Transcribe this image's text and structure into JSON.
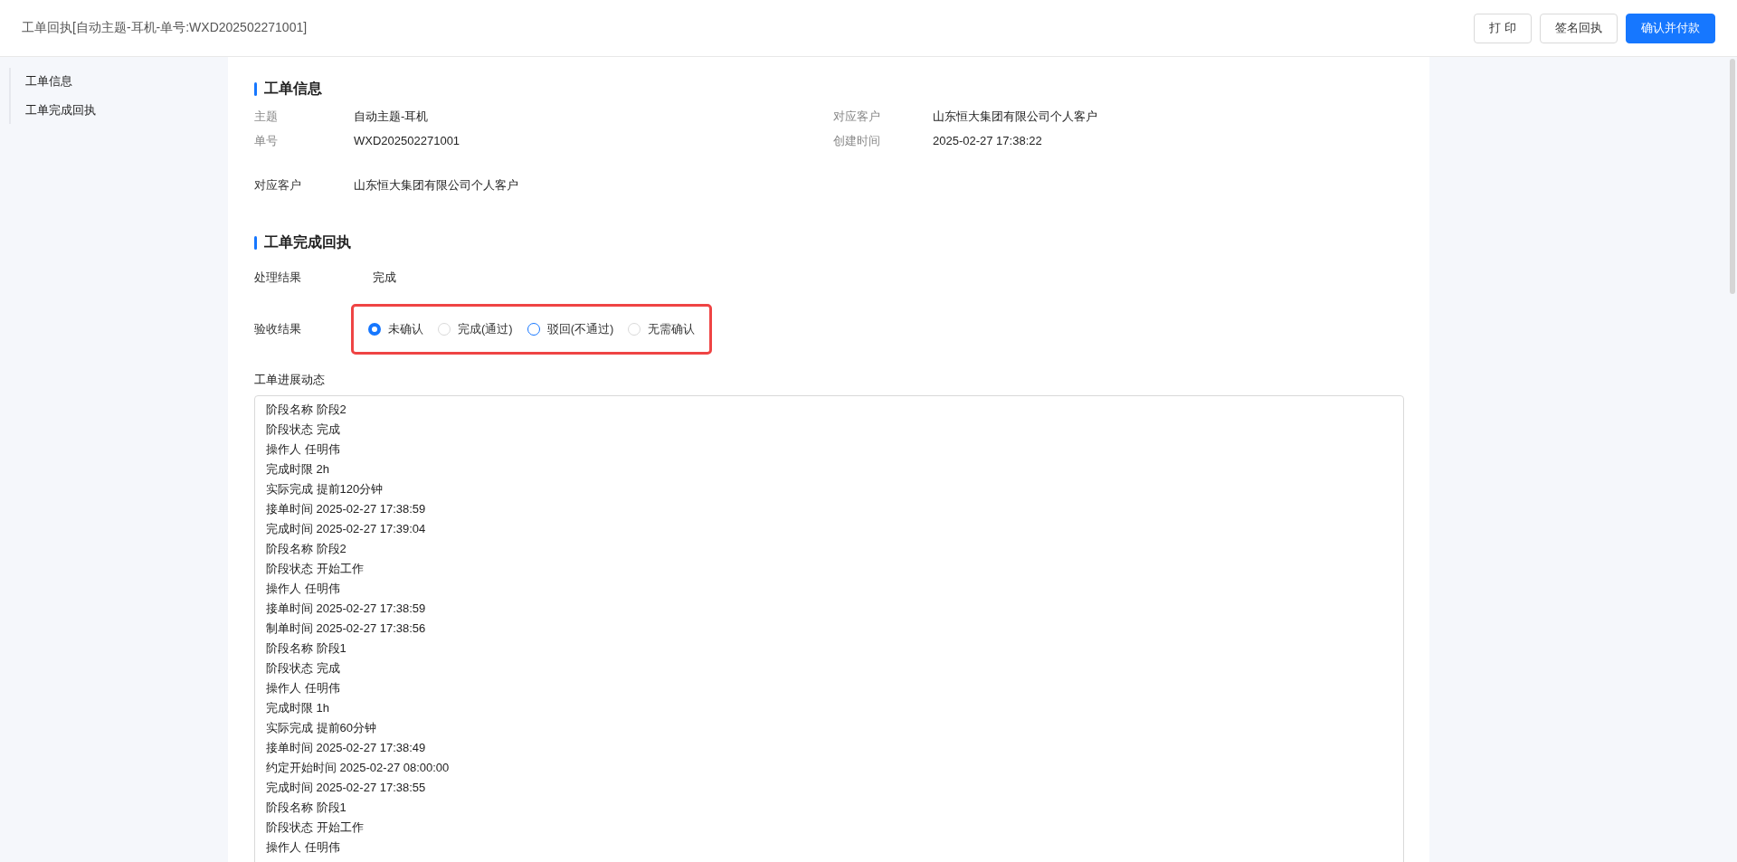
{
  "header": {
    "title": "工单回执[自动主题-耳机-单号:WXD202502271001]",
    "buttons": [
      {
        "label": "打 印",
        "kind": "default"
      },
      {
        "label": "签名回执",
        "kind": "default"
      },
      {
        "label": "确认并付款",
        "kind": "primary"
      }
    ]
  },
  "sidebar": {
    "items": [
      {
        "label": "工单信息"
      },
      {
        "label": "工单完成回执"
      }
    ]
  },
  "order_info": {
    "title": "工单信息",
    "fields": [
      {
        "label": "主题",
        "value": "自动主题-耳机"
      },
      {
        "label": "对应客户",
        "value": "山东恒大集团有限公司个人客户"
      },
      {
        "label": "单号",
        "value": "WXD202502271001"
      },
      {
        "label": "创建时间",
        "value": "2025-02-27 17:38:22"
      }
    ],
    "customer": {
      "label": "对应客户",
      "value": "山东恒大集团有限公司个人客户"
    }
  },
  "receipt": {
    "title": "工单完成回执",
    "result": {
      "label": "处理结果",
      "value": "完成"
    },
    "acceptance": {
      "label": "验收结果",
      "highlighted": true,
      "options": [
        {
          "label": "未确认",
          "selected": true,
          "hovered": false
        },
        {
          "label": "完成(通过)",
          "selected": false,
          "hovered": false
        },
        {
          "label": "驳回(不通过)",
          "selected": false,
          "hovered": true
        },
        {
          "label": "无需确认",
          "selected": false,
          "hovered": false
        }
      ]
    },
    "progress": {
      "label": "工单进展动态",
      "lines": [
        "阶段名称 阶段2",
        "阶段状态 完成",
        "操作人 任明伟",
        "完成时限 2h",
        "实际完成 提前120分钟",
        "接单时间 2025-02-27 17:38:59",
        "完成时间 2025-02-27 17:39:04",
        "阶段名称 阶段2",
        "阶段状态 开始工作",
        "操作人 任明伟",
        "接单时间 2025-02-27 17:38:59",
        "制单时间 2025-02-27 17:38:56",
        "阶段名称 阶段1",
        "阶段状态 完成",
        "操作人 任明伟",
        "完成时限 1h",
        "实际完成 提前60分钟",
        "接单时间 2025-02-27 17:38:49",
        "约定开始时间 2025-02-27 08:00:00",
        "完成时间 2025-02-27 17:38:55",
        "阶段名称 阶段1",
        "阶段状态 开始工作",
        "操作人 任明伟"
      ]
    }
  }
}
